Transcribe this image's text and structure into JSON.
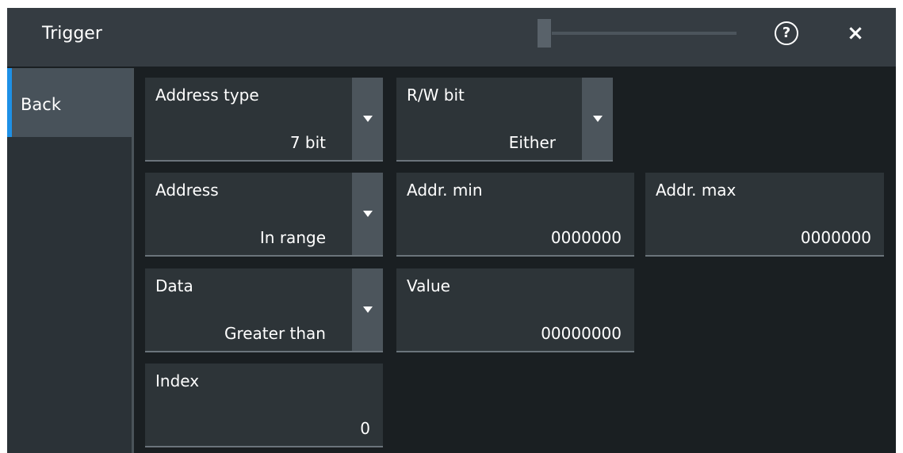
{
  "title": "Trigger",
  "header": {
    "help_icon": "?",
    "close_icon": "×"
  },
  "sidebar": {
    "back_label": "Back"
  },
  "fields": {
    "address_type": {
      "label": "Address type",
      "value": "7 bit"
    },
    "rw_bit": {
      "label": "R/W bit",
      "value": "Either"
    },
    "address": {
      "label": "Address",
      "value": "In range"
    },
    "addr_min": {
      "label": "Addr. min",
      "value": "0000000"
    },
    "addr_max": {
      "label": "Addr. max",
      "value": "0000000"
    },
    "data": {
      "label": "Data",
      "value": "Greater than"
    },
    "value": {
      "label": "Value",
      "value": "00000000"
    },
    "index": {
      "label": "Index",
      "value": "0"
    }
  }
}
